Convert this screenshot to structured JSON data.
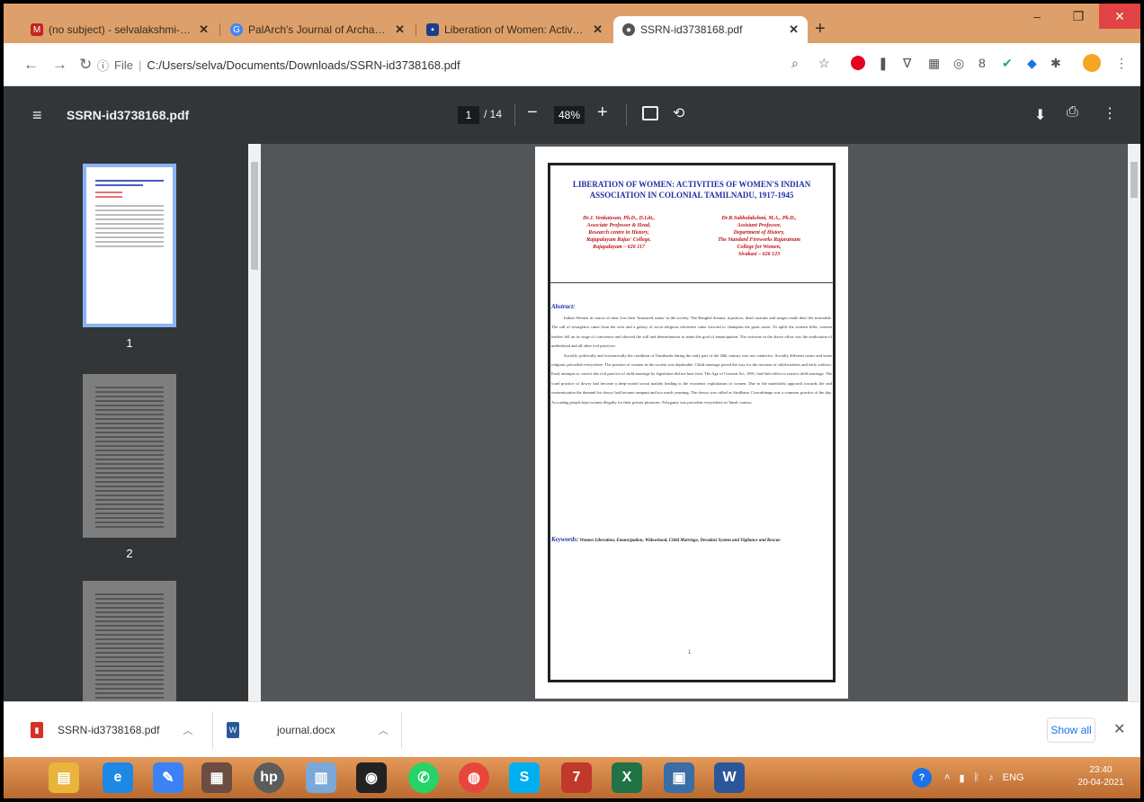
{
  "browser": {
    "tabs": [
      {
        "title": "(no subject) - selvalakshmi-phy@",
        "favicon": "gmail-icon",
        "color": "#c5221f",
        "active": false
      },
      {
        "title": "PalArch's Journal of Archaeology",
        "favicon": "google-icon",
        "color": "#4285f4",
        "active": false
      },
      {
        "title": "Liberation of Women: Activities",
        "favicon": "ssrn-icon",
        "color": "#1f3c88",
        "active": false
      },
      {
        "title": "SSRN-id3738168.pdf",
        "favicon": "globe-icon",
        "color": "#555555",
        "active": true
      }
    ],
    "new_tab": "+",
    "window_controls": {
      "minimize": "–",
      "maximize": "❐",
      "close": "✕"
    },
    "address": {
      "info": "ⓘ",
      "prefix": "File",
      "url": "C:/Users/selva/Documents/Downloads/SSRN-id3738168.pdf"
    }
  },
  "pdf_toolbar": {
    "menu": "≡",
    "title": "SSRN-id3738168.pdf",
    "page_current": "1",
    "page_total": "/ 14",
    "zoom_minus": "−",
    "zoom": "48%",
    "zoom_plus": "+",
    "rotate": "⟲",
    "download": "⬇",
    "print": "⎙",
    "more": "⋮"
  },
  "thumbnails": [
    {
      "number": "1",
      "selected": true
    },
    {
      "number": "2",
      "selected": false
    },
    {
      "number": "3",
      "selected": false
    }
  ],
  "document": {
    "title": "LIBERATION OF WOMEN: ACTIVITIES OF WOMEN'S INDIAN ASSOCIATION IN COLONIAL TAMILNADU, 1917-1945",
    "author1": [
      "Dr.J. Venkatesan, Ph.D., D.Litt.,",
      "Associate Professor & Head,",
      "Research centre in History,",
      "Rajapalayam Rajus' College,",
      "Rajapalayam – 626 117"
    ],
    "author2": [
      "Dr.R.Subbulakshmi, M.A., Ph.D.,",
      "Assistant Professor,",
      "Department of History,",
      "The Standard Fireworks Rajaratnam",
      "College for Women,",
      "Sivakasi – 626 123"
    ],
    "abstract_heading": "Abstract:",
    "abstract_p1": "Indian Women in course of time, lost their 'honoured status' in the society. The Bangled dreams, injustices, dead customs and usages made their life miserable. The call of resurgence came from the west and a galaxy of socio-religious reformers came forward to champion the great cause. To uplift the women folks, women leaders fell on its stage of conscience and showed the will and determination to attain the goal of emancipation. The outcome in the above effort was the eradication of undershead and all other evil practices.",
    "abstract_p2": "Socially, politically and economically the condition of Tamilnadu during the early part of the 20th century was not conducive. Socially different castes and some religions prevailed everywhere. The position of women in the society was deplorable. Child marriage paved the way for the increase of child mothers and early widows. Early attempts to correct this evil practice of child marriage by legislation did not bear fruit. The Age of Consent Act, 1891, had little effect to restrict child marriage. The cruel practice of dowry had become a deep-rooted social malady leading to the economic exploitation of women. Due to the materialist approach towards life and westernization the demand for dowry had become rampant and too much yearning. The dowry was called as Stridhana. Concubinage was a common practice of the day. According people kept women illegally for their private pleasures. Polygamy was prevalent everywhere in Tamil country.",
    "keywords_label": "Keywords:",
    "keywords": "Women Liberation, Emancipation, Widowhood, Child Marriage, Devadasi System and Vigilance and Rescue",
    "page_number": "1"
  },
  "downloads": [
    {
      "name": "SSRN-id3738168.pdf",
      "icon": "pdf-file-icon",
      "color": "#d93025"
    },
    {
      "name": "journal.docx",
      "icon": "word-file-icon",
      "color": "#2b579a"
    }
  ],
  "show_all": "Show all",
  "download_close": "✕",
  "taskbar": {
    "apps": [
      {
        "name": "file-explorer",
        "label": "▤",
        "color": "#e8b43a"
      },
      {
        "name": "internet-explorer",
        "label": "e",
        "color": "#1e88e5"
      },
      {
        "name": "pen-app",
        "label": "✎",
        "color": "#3b82f6"
      },
      {
        "name": "paint-app",
        "label": "▦",
        "color": "#6d4c41"
      },
      {
        "name": "hp-app",
        "label": "hp",
        "color": "#5c5c5c"
      },
      {
        "name": "notes-app",
        "label": "▥",
        "color": "#7aa8d8"
      },
      {
        "name": "camera-app",
        "label": "◉",
        "color": "#222222"
      },
      {
        "name": "whatsapp",
        "label": "✆",
        "color": "#25d366"
      },
      {
        "name": "chrome",
        "label": "◍",
        "color": "#e8453c"
      },
      {
        "name": "skype",
        "label": "S",
        "color": "#00aff0"
      },
      {
        "name": "media-app",
        "label": "7",
        "color": "#c0392b"
      },
      {
        "name": "excel",
        "label": "X",
        "color": "#217346"
      },
      {
        "name": "network-app",
        "label": "▣",
        "color": "#3a6ea5"
      },
      {
        "name": "word",
        "label": "W",
        "color": "#2b579a"
      }
    ],
    "lang": "ENG",
    "time": "23:40",
    "date": "20-04-2021"
  }
}
